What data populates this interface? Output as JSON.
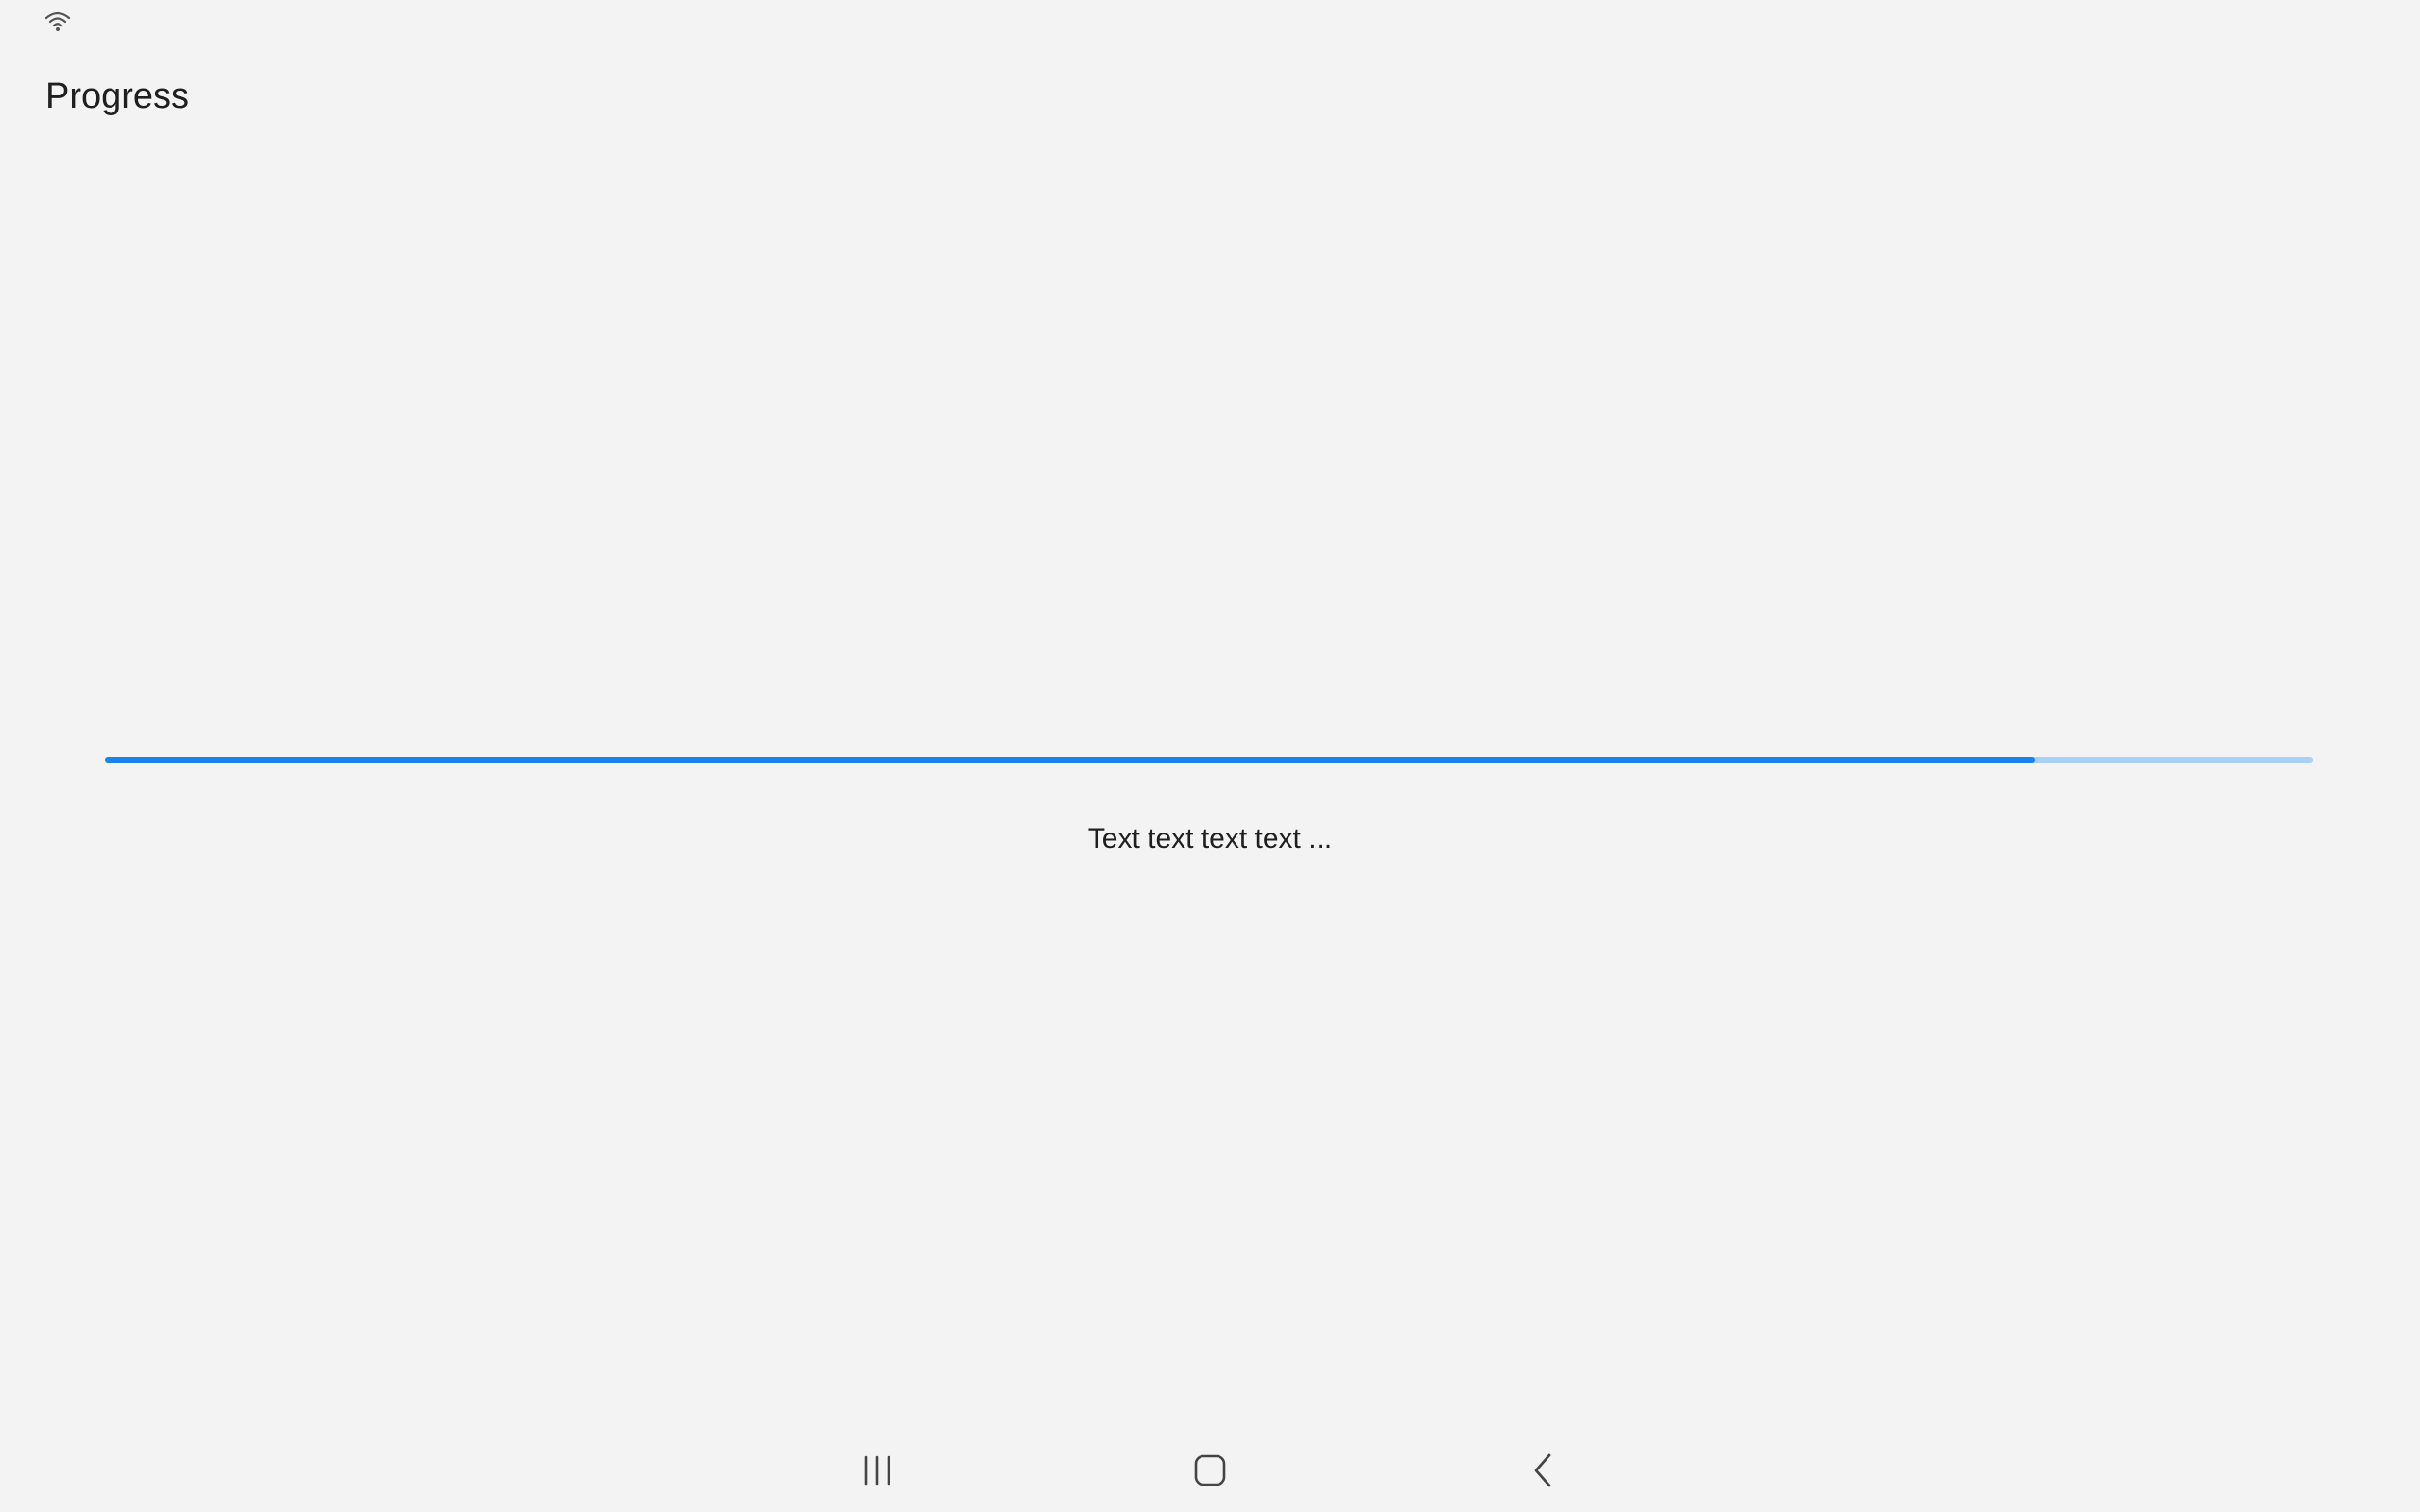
{
  "status_bar": {
    "wifi_icon": "wifi-icon"
  },
  "header": {
    "title": "Progress"
  },
  "progress": {
    "value_percent": 87.4,
    "caption": "Text text text text ...",
    "fill_color": "#1a82ea",
    "track_color": "#a9d1f6"
  },
  "navigation_bar": {
    "recents_icon": "recents-icon",
    "home_icon": "home-icon",
    "back_icon": "back-icon"
  }
}
